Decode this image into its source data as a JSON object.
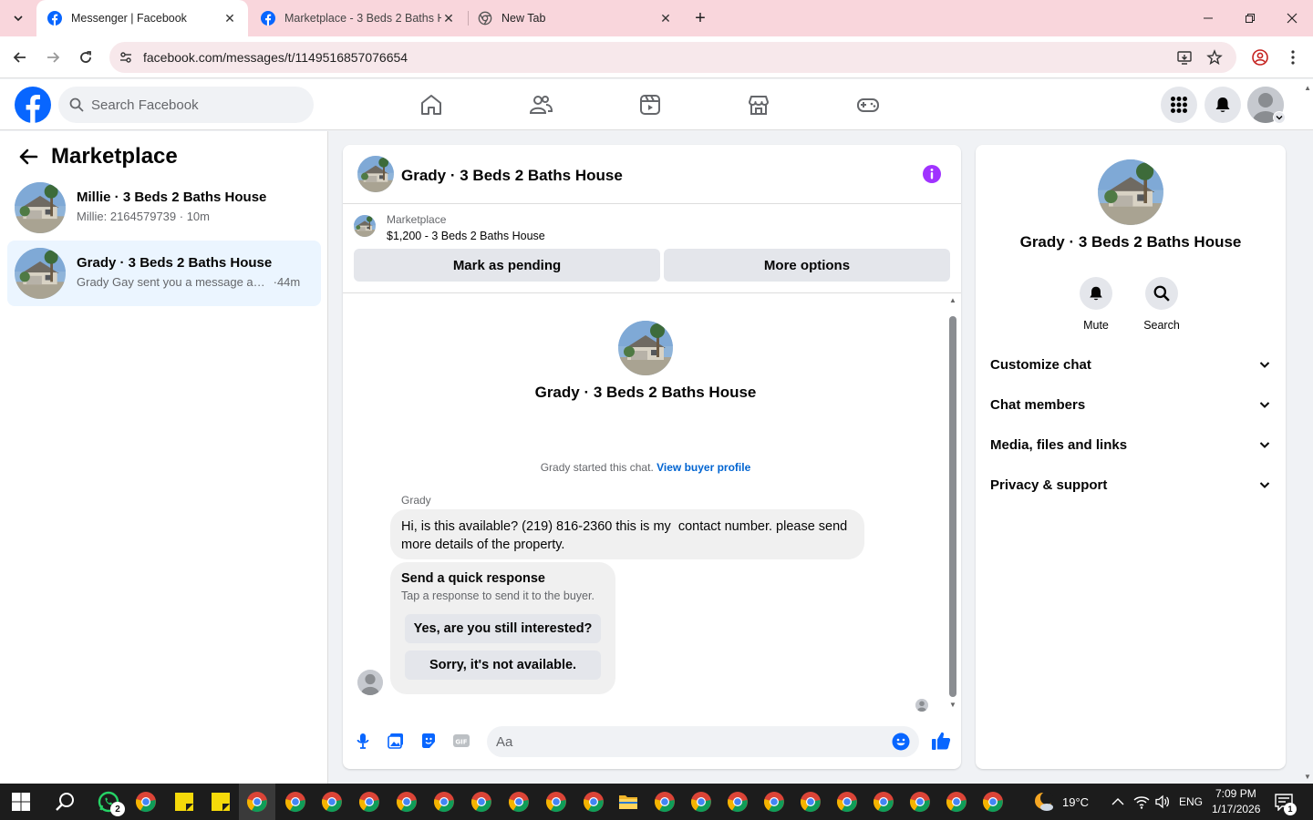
{
  "browser": {
    "tabs": [
      {
        "title": "Messenger | Facebook",
        "active": true
      },
      {
        "title": "Marketplace - 3 Beds 2 Baths H",
        "active": false
      },
      {
        "title": "New Tab",
        "active": false
      }
    ],
    "url": "facebook.com/messages/t/1149516857076654"
  },
  "fb_nav": {
    "search_placeholder": "Search Facebook",
    "nav_icons": [
      "home-icon",
      "friends-icon",
      "video-icon",
      "marketplace-icon",
      "gaming-icon"
    ],
    "right_icons": [
      "menu-grid-icon",
      "notifications-icon",
      "account-avatar"
    ]
  },
  "left_panel": {
    "title": "Marketplace",
    "conversations": [
      {
        "name": "Millie · 3 Beds 2 Baths House",
        "preview": "Millie: 2164579739",
        "time": "10m",
        "selected": false
      },
      {
        "name": "Grady · 3 Beds 2 Baths House",
        "preview": "Grady Gay sent you a message abo...",
        "time": "44m",
        "selected": true
      }
    ]
  },
  "chat": {
    "title": "Grady · 3 Beds 2 Baths House",
    "listing": {
      "label": "Marketplace",
      "price_title": "$1,200 - 3 Beds 2 Baths House",
      "mark_pending": "Mark as pending",
      "more_options": "More options"
    },
    "intro_name": "Grady · 3 Beds 2 Baths House",
    "started_text": "Grady started this chat.",
    "view_profile": "View buyer profile",
    "sender": "Grady",
    "message": "Hi, is this available? (219) 816-2360 this is my  contact number. please send more details of the property.",
    "quick_response": {
      "title": "Send a quick response",
      "subtitle": "Tap a response to send it to the buyer.",
      "options": [
        "Yes, are you still interested?",
        "Sorry, it's not available."
      ]
    },
    "composer_placeholder": "Aa"
  },
  "right_panel": {
    "name": "Grady · 3 Beds 2 Baths House",
    "actions": [
      {
        "label": "Mute",
        "icon": "bell-icon"
      },
      {
        "label": "Search",
        "icon": "search-icon"
      }
    ],
    "sections": [
      "Customize chat",
      "Chat members",
      "Media, files and links",
      "Privacy & support"
    ]
  },
  "taskbar": {
    "weather": "19°C",
    "language": "ENG",
    "time": "7:09 PM",
    "date": "1/17/2026",
    "whatsapp_badge": "2",
    "notification_badge": "1"
  },
  "colors": {
    "fb_blue": "#0866ff",
    "link_blue": "#0064d1",
    "info_purple": "#a033ff",
    "tab_strip": "#f9d6dc"
  }
}
